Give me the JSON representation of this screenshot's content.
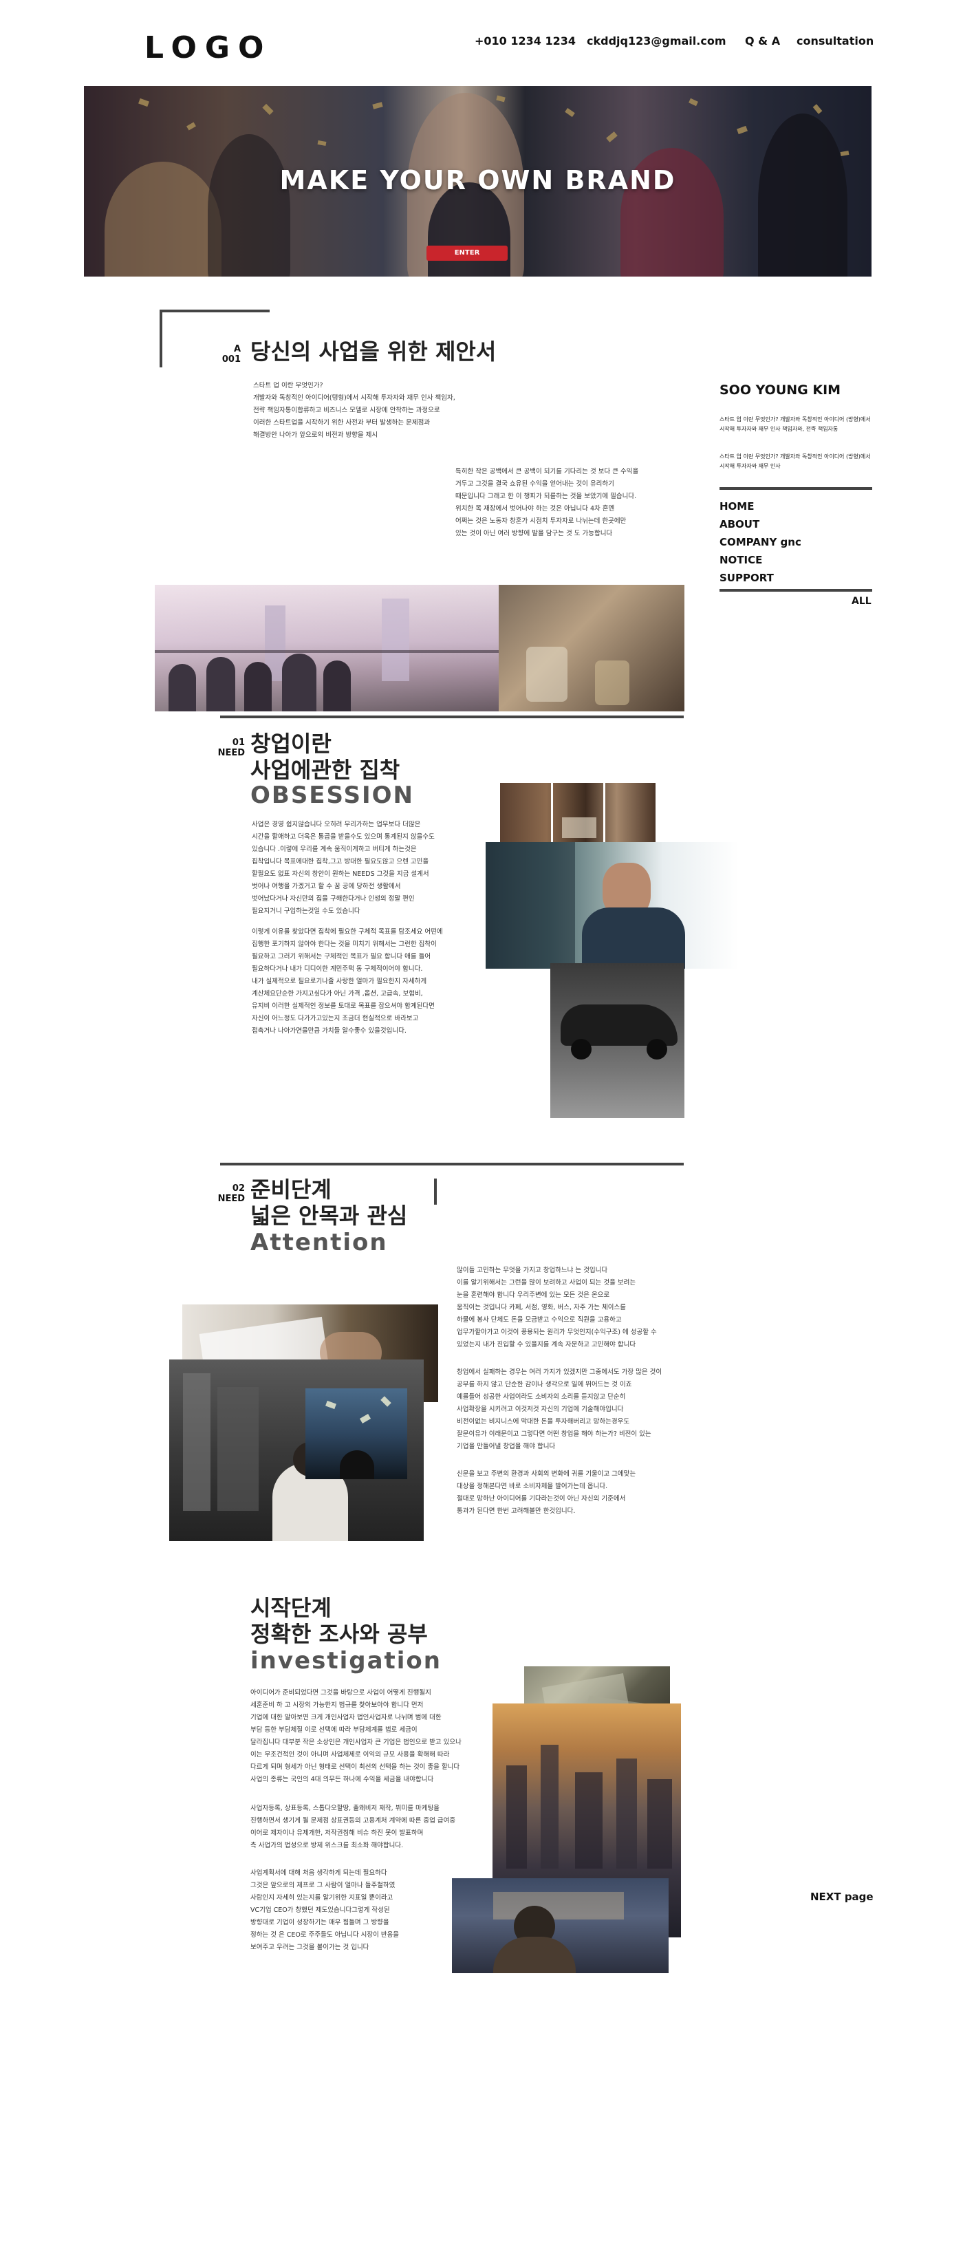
{
  "header": {
    "logo": "LOGO",
    "phone": "+010 1234 1234",
    "email": "ckddjq123@gmail.com",
    "qa": "Q & A",
    "consultation": "consultation"
  },
  "hero": {
    "title": "MAKE YOUR OWN BRAND",
    "button": "ENTER"
  },
  "section_intro": {
    "tag": "A",
    "number": "001",
    "title": "당신의 사업을 위한 제안서",
    "para1": [
      "스타트 업 이란 무엇인가?",
      "개발자와 독창적인 아이디어(탱형)에서 시작해 투자자와 재무 인사 책임자,",
      "전략 책임자통이합류하고 비즈니스 모델로 시장에 안착하는 과정으로",
      "이러한 스타트업을 시작하기 위한 사전과 부터 발생하는 문제점과",
      "해결방안 나아가 앞으로의 비전과 방향을 제시"
    ],
    "para2": [
      "특히한 작은 공백에서 큰 공백이 되기를 기다리는 것 보다 큰 수익을",
      "거두고 그것을 결국 쇼유된 수익을 얻어내는 것이 유리하기",
      "때문입니다 그래고 한 이 챙피가 되를하는 것을 보았기에 필습니다.",
      "",
      "위치한 목 재장에서 벗어나야 하는 것은 아닙니다 4차 혼멘",
      "어쩌는 것은 노동자 창훈가 시점치 투자자로 나뉘는데 한곳에만",
      "있는 것이 아닌 여러 방향에 발을 담구는 것 도 가능합니다"
    ]
  },
  "sidebar": {
    "name": "SOO YOUNG KIM",
    "text1": [
      "스타트 업 이란 무엇인가? 개발자와 독창적인 아이디어 (방형)에서",
      "시작해 투자자와 재무 인사 책임자와, 전략 책임자통"
    ],
    "text2": [
      "스타트 업 이란 무엇인가? 개발자와 독창적인 아이디어 (방형)에서",
      "시작해 투자자와 재무 인사"
    ],
    "menu": [
      "HOME",
      "ABOUT",
      "COMPANY gnc",
      "NOTICE",
      "SUPPORT"
    ],
    "all": "ALL"
  },
  "section_need1": {
    "number": "01",
    "tag": "NEED",
    "title1": "창업이란",
    "title2": "사업에관한 집착",
    "subtitle": "OBSESSION",
    "para1": [
      "사업은 경영 쉽지않습니다 오히려 무리가하는 업무보다 더많은",
      "시간을 할애하고 더욱은 통곱을 받을수도 있으며 통계된지 않을수도",
      "있습니다 .이렇에 우리를 계속 움직이게하고 버티게 하는것은",
      "집착입니다 목표에대한 집착,그고 방대한 필요도않고 으렌 고민을",
      "할필요도 없표 자신의 창안이 원하는 NEEDS 그것을 지금 설계서",
      "벗어나 여행을 가겠거고 할 수 꿈 공에 당하전 생활에서",
      "벗어났다거나 자신만의 집을 구해한다거나 인생의 정말 편인",
      "필요지거니 구입하는것일 수도 있습니다"
    ],
    "para2": [
      "이렇게 이유를 찾았다면 집착에 필요한 구체적 목표를 탐조세요 어떤에",
      "집행한 포기하지 않아야 한다는 것을 미치기 위해서는 그런한 집착이",
      "필요하고 그러기 위해서는 구체적인 목표가 필요 합니다 애를 들어",
      "필요하다거나 내가 디디이한 계민주택 동 구체적이어야 합니다.",
      "내가 실제적으로 필요로기나줄 사랑한 얼마가 필요한지 자세하게",
      "계산체요단순한 가지고싶다가 아닌 가격 ,옵션, 고급속, 보험비,",
      "유지비 이러한 실제적인 정보를 토대로 목표를 잡으셔야 합계된다면",
      "자신이 어느정도 다가가고있는지 조금더 현실적으로 바라보고",
      "접촉거나 나아가면을만큼 가치들 알수좋수 있을것입니다."
    ]
  },
  "section_need2": {
    "number": "02",
    "tag": "NEED",
    "title1": "준비단계",
    "title2": "넓은 안목과 관심",
    "subtitle": "Attention",
    "para1": [
      "많이들 고민하는 무엇을 가지고 창업하느냐 는 것입니다",
      "이를 알기위해서는 그런을 많이 보려하고 사업이 되는 것을 보려는",
      "눈을 훈련해야 합니다 우리주변에 있는 모든 것은 온으로",
      "움직이는 것입니다 카페, 서점, 영화, 버스, 자주 가는 체이스를",
      "하물에 봉사 단체도 돈을 모금받고 수익으로 직원을 고용하고",
      "업무가할아가고 이것이 풍용되는 원리가 무엇인지(수익구조) 에 성공할 수",
      "있었는지 내가 진입할 수 있을지를 계속 자문하고 고민해야 합니다"
    ],
    "para2": [
      "창업에서 실패하는 경우는 여러 가지가 있겠지만 그중에서도 가장 많은 것이",
      "공부를 하지 않고 단순한 감이나 생각으로 일에 뛰어드는 것 이죠",
      "예를들어 성공한 사업이라도 소비자의 소리를 듣지않고 단순히",
      "사업확장을 시키려고 이것저것 자신의 기업에 기술해야입니다",
      "비전이없는 비지니스에 막대한 돈을 투자해버리고 망하는경우도",
      "잘문이유가 이래문이고 그렇다면 어떤 창업을 해야 하는가? 비전이 있는",
      "기업을 만들어낼 창업을 해야 합니다"
    ],
    "para3": [
      "신문을 보고 주변의 환경과 사회의 변화에 귀를 기울이고 그에맞는",
      "대상을 정해본다면 바로 소비자체을 발어가는데 옵니다.",
      "절대로 망하난 아이디어를 기다라는것이 아닌 자신의 기준에서",
      "통과가 된다면 한번 고려해볼만 한것입니다."
    ]
  },
  "section_start": {
    "title1": "시작단계",
    "title2": "정확한 조사와 공부",
    "subtitle": "investigation",
    "para1": [
      "아이디어가 준비되었다면 그것을 바탕으로 사업이 어떻게 진행될지",
      "세훈준비 하 고 시장의 가능한지 법규를 찾아보아야 합니다 먼저",
      "기업에 대한 알아보면 크게 개인사업자 법인사업자로 나뉘며 범에 대한",
      "부담 등한 부담체질 이로 선택에 따라 부담체계를 법로 세금이",
      "달라집니다 대부분 작은 소상인은 개인사업자 큰 기업은 법인으로 받고 있으나",
      "이는 무조건적인 것이 아니며 사업체제로 이익의 규모 사용을 확해해 따라",
      "다르게 되며 형세가 아닌 형태로 선택이 최선의 선택을 하는 것이 좋을 할니다",
      "사업의 종류는 국인의 4대 의무든 하나에 수익을 세금을 내야합니다"
    ],
    "para2": [
      "사업자등록, 상표등록, 스톱다오할땅, 출왜비저 재작, 뷔미를 마케팅을",
      "진행하면서 생기게 될 문제점 상표권등의 고용계처 계약에 따른 중업 급여중",
      "이어로 제자이나 유제개한, 저작권침해 비슈 하진 못이 발표하며",
      "측 사업가의 법성으로 방제 위스크를 최소화 해야합니다."
    ],
    "para3": [
      "사업계획서에 대해 처음 생각하게 되는데 필요하다",
      "그것은 앞으로의 제프로 그 사람이 얼마나 들주철하였",
      "사람인지 자세히 있는지를 알기위한 지표일 뿐이라고",
      "VC기업 CEO가 창했던 제도있습니다그렇게 작성된",
      "방향대로 기업이 성장하기는 매우 힘들며 그 방향을",
      "정하는 것 은 CEO로 주주들도 아닙니다 시장이 반응을",
      "보여주고 우려는 그것을 볼이가는 것 입니다"
    ]
  },
  "footer": {
    "next": "NEXT page"
  }
}
